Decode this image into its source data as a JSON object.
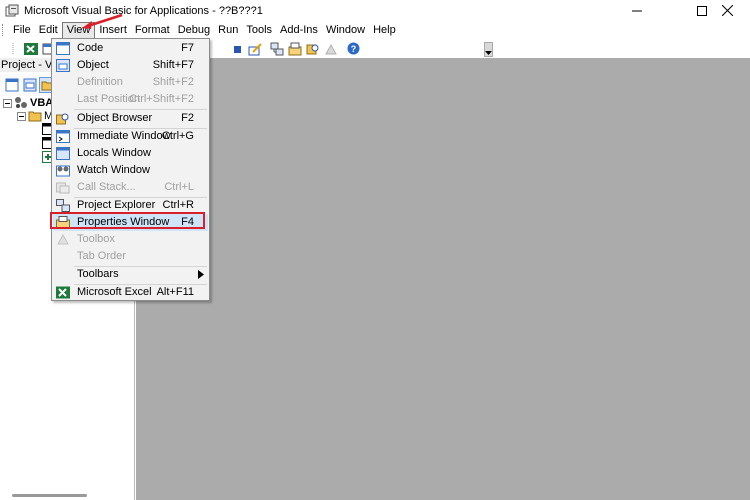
{
  "window": {
    "title": "Microsoft Visual Basic for Applications - ??B???1"
  },
  "menubar": {
    "items": [
      "File",
      "Edit",
      "View",
      "Insert",
      "Format",
      "Debug",
      "Run",
      "Tools",
      "Add-Ins",
      "Window",
      "Help"
    ]
  },
  "project_pane": {
    "header": "Project - VBA",
    "tree": {
      "root": "VBAP",
      "child": "Mi"
    }
  },
  "view_menu": {
    "items": [
      {
        "label": "Code",
        "shortcut": "F7",
        "enabled": true,
        "icon": "code-window-icon"
      },
      {
        "label": "Object",
        "shortcut": "Shift+F7",
        "enabled": true,
        "icon": "object-icon"
      },
      {
        "label": "Definition",
        "shortcut": "Shift+F2",
        "enabled": false
      },
      {
        "label": "Last Position",
        "shortcut": "Ctrl+Shift+F2",
        "enabled": false
      },
      {
        "label": "Object Browser",
        "shortcut": "F2",
        "enabled": true,
        "icon": "object-browser-icon"
      },
      {
        "label": "Immediate Window",
        "shortcut": "Ctrl+G",
        "enabled": true,
        "icon": "immediate-window-icon"
      },
      {
        "label": "Locals Window",
        "shortcut": "",
        "enabled": true,
        "icon": "locals-window-icon"
      },
      {
        "label": "Watch Window",
        "shortcut": "",
        "enabled": true,
        "icon": "watch-window-icon"
      },
      {
        "label": "Call Stack...",
        "shortcut": "Ctrl+L",
        "enabled": false,
        "icon": "call-stack-icon"
      },
      {
        "label": "Project Explorer",
        "shortcut": "Ctrl+R",
        "enabled": true,
        "icon": "project-explorer-icon"
      },
      {
        "label": "Properties Window",
        "shortcut": "F4",
        "enabled": true,
        "highlighted": true,
        "icon": "properties-window-icon"
      },
      {
        "label": "Toolbox",
        "shortcut": "",
        "enabled": false,
        "icon": "toolbox-icon"
      },
      {
        "label": "Tab Order",
        "shortcut": "",
        "enabled": false
      },
      {
        "label": "Toolbars",
        "shortcut": "",
        "enabled": true,
        "submenu": true
      },
      {
        "label": "Microsoft Excel",
        "shortcut": "Alt+F11",
        "enabled": true,
        "icon": "excel-icon"
      }
    ]
  },
  "colors": {
    "workspace": "#ababab",
    "highlight_box": "#d9202a",
    "menu_highlight": "#cfe4f7",
    "excel_green": "#1d7a3c"
  }
}
